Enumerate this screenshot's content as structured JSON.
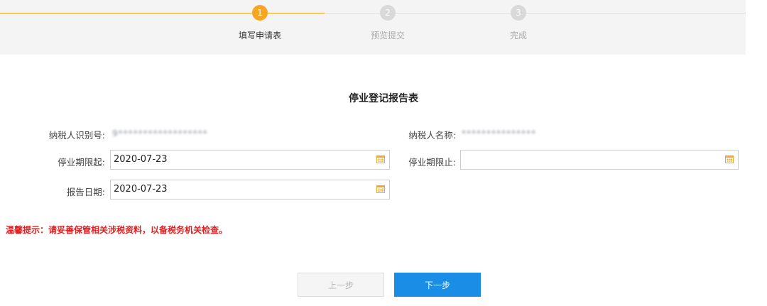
{
  "steps": [
    {
      "number": "1",
      "label": "填写申请表",
      "active": true
    },
    {
      "number": "2",
      "label": "预览提交",
      "active": false
    },
    {
      "number": "3",
      "label": "完成",
      "active": false
    }
  ],
  "form": {
    "title": "停业登记报告表",
    "taxpayer_id_label": "纳税人识别号:",
    "taxpayer_id_value": "9******************",
    "taxpayer_name_label": "纳税人名称:",
    "taxpayer_name_value": "***************",
    "start_date_label": "停业期限起:",
    "start_date_value": "2020-07-23",
    "end_date_label": "停业期限止:",
    "end_date_value": "",
    "report_date_label": "报告日期:",
    "report_date_value": "2020-07-23"
  },
  "tip": "温馨提示：请妥善保管相关涉税资料，以备税务机关检查。",
  "buttons": {
    "prev": "上一步",
    "next": "下一步"
  },
  "colors": {
    "accent": "#f6a623",
    "primary": "#1a8ee6",
    "warning": "#e02020"
  }
}
